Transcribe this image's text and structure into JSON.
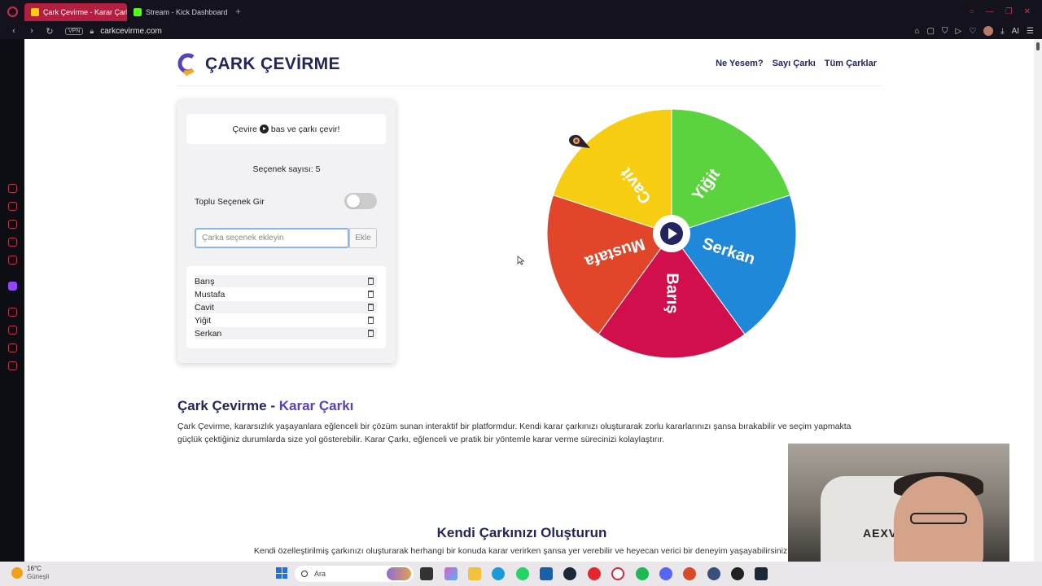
{
  "browser": {
    "tabs": [
      {
        "label": "Çark Çevirme - Karar Çark",
        "active": true,
        "color": "#b3203f"
      },
      {
        "label": "Stream - Kick Dashboard",
        "active": false,
        "color": "#53fc18"
      }
    ],
    "vpn_label": "VPN",
    "url": "carkcevirme.com",
    "ai_label": "AI"
  },
  "site": {
    "logo_text": "ÇARK ÇEVİRME",
    "nav": [
      "Ne Yesem?",
      "Sayı Çarkı",
      "Tüm Çarklar"
    ],
    "brand_color": "#23255e",
    "accent_color": "#5a3fbf"
  },
  "panel": {
    "hint_before": "Çevire",
    "hint_after": "bas ve çarkı çevir!",
    "count_text": "Seçenek sayısı: 5",
    "bulk_label": "Toplu Seçenek Gir",
    "bulk_enabled": false,
    "input_placeholder": "Çarka seçenek ekleyin",
    "input_value": "",
    "add_button": "Ekle",
    "options": [
      "Barış",
      "Mustafa",
      "Cavit",
      "Yiğit",
      "Serkan"
    ]
  },
  "wheel": {
    "segments": [
      {
        "label": "Yiğit",
        "color": "#5bd33f"
      },
      {
        "label": "Serkan",
        "color": "#1f88d9"
      },
      {
        "label": "Barış",
        "color": "#d10f4d"
      },
      {
        "label": "Mustafa",
        "color": "#e2462a"
      },
      {
        "label": "Cavit",
        "color": "#f7cd12"
      }
    ],
    "center_icon": "play-icon"
  },
  "content": {
    "h2a_part1": "Çark Çevirme - ",
    "h2a_part2": "Karar Çarkı",
    "para1": "Çark Çevirme, kararsızlık yaşayanlara eğlenceli bir çözüm sunan interaktif bir platformdur. Kendi karar çarkınızı oluşturarak zorlu kararlarınızı şansa bırakabilir ve seçim yapmakta güçlük çektiğiniz durumlarda size yol gösterebilir. Karar Çarkı, eğlenceli ve pratik bir yöntemle karar verme sürecinizi kolaylaştırır.",
    "h2b": "Kendi Çarkınızı Oluşturun",
    "para2": "Kendi özelleştirilmiş çarkınızı oluşturarak herhangi bir konuda karar verirken şansa yer verebilir ve heyecan verici bir deneyim yaşayabilirsiniz."
  },
  "webcam": {
    "shirt_text": "AEXVEG"
  },
  "taskbar": {
    "temp": "16°C",
    "condition": "Güneşli",
    "search_placeholder": "Ara"
  }
}
